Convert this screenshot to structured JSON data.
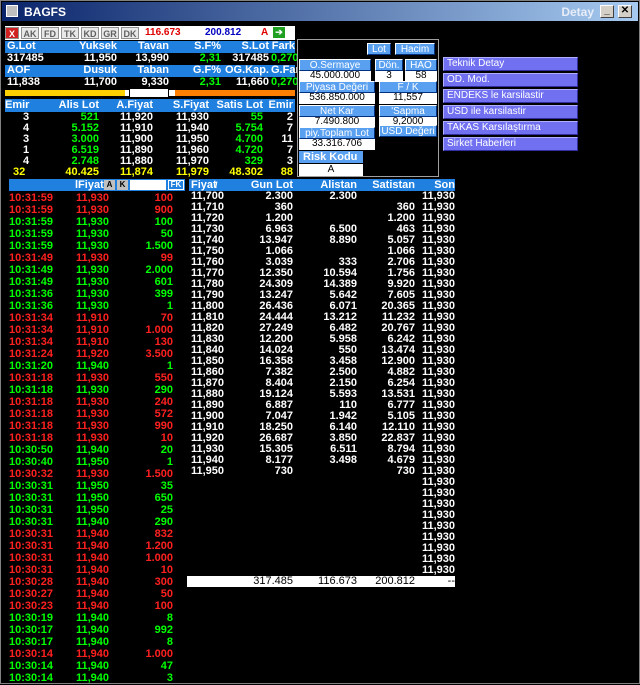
{
  "window": {
    "title": "BAGFS",
    "detail": "Detay"
  },
  "toolbar": {
    "close_label": "X",
    "tabs": [
      "AK",
      "FD",
      "TK",
      "KD",
      "GR",
      "DK"
    ],
    "price_red": "116.673",
    "price_blue": "200.812",
    "a_label": "A"
  },
  "summary": {
    "row1_headers": [
      "G.Lot",
      "Yuksek",
      "Tavan",
      "S.F%",
      "S.Lot",
      "Fark"
    ],
    "row1_values": [
      "317485",
      "11,950",
      "13,990",
      "2,31",
      "317485",
      "0,270"
    ],
    "row2_headers": [
      "AOF",
      "Dusuk",
      "Taban",
      "G.F%",
      "OG.Kap.",
      "G.Fark"
    ],
    "row2_values": [
      "11,838",
      "11,700",
      "9,330",
      "2,31",
      "11,660",
      "0,270"
    ]
  },
  "info_panel": {
    "lot_label": "Lot",
    "hacim_label": "Hacim",
    "osermaye_label": "O.Sermaye",
    "osermaye_value": "45.000.000",
    "don_label": "Dön.",
    "don_value": "3",
    "hao_label": "HAO",
    "hao_value": "58",
    "piyasa_label": "Piyasa Değeri",
    "piyasa_value": "536.850.000",
    "fk_label": "F / K",
    "fk_value": "11,557",
    "netkar_label": "Net Kar",
    "netkar_value": "7.490.800",
    "sapma_label": "'Sapma",
    "sapma_value": "9,2000",
    "ptoplam_label": "piy.Toplam Lot",
    "ptoplam_value": "33.316.706",
    "usd_label": "USD Değeri",
    "risk_label": "Risk Kodu",
    "risk_value": "A"
  },
  "menu": [
    "Teknik Detay",
    "OD. Mod.",
    "ENDEKS le karsilastir",
    "USD ile karsilastir",
    "TAKAS Karsılaştırma",
    "Sirket Haberleri"
  ],
  "depth": {
    "headers": [
      "Emir",
      "Alis Lot",
      "A.Fiyat",
      "S.Fiyat",
      "Satis Lot",
      "Emir"
    ],
    "rows": [
      [
        "3",
        "521",
        "11,920",
        "11,930",
        "55",
        "2"
      ],
      [
        "4",
        "5.152",
        "11,910",
        "11,940",
        "5.754",
        "7"
      ],
      [
        "3",
        "3.000",
        "11,900",
        "11,950",
        "4.700",
        "11"
      ],
      [
        "1",
        "6.519",
        "11,890",
        "11,960",
        "4.720",
        "7"
      ],
      [
        "4",
        "2.748",
        "11,880",
        "11,970",
        "329",
        "3"
      ]
    ],
    "totals": [
      "32",
      "40.425",
      "11,874",
      "11,979",
      "48.302",
      "88"
    ]
  },
  "trades": {
    "header_fiyat": "lFiyat",
    "a_btn": "A",
    "k_btn": "K",
    "fk_btn": "FK",
    "rows": [
      [
        "10:31:59",
        "11,930",
        "100",
        "r"
      ],
      [
        "10:31:59",
        "11,930",
        "900",
        "r"
      ],
      [
        "10:31:59",
        "11,930",
        "100",
        "g"
      ],
      [
        "10:31:59",
        "11,930",
        "50",
        "g"
      ],
      [
        "10:31:59",
        "11,930",
        "1.500",
        "g"
      ],
      [
        "10:31:49",
        "11,930",
        "99",
        "r"
      ],
      [
        "10:31:49",
        "11,930",
        "2.000",
        "g"
      ],
      [
        "10:31:49",
        "11,930",
        "601",
        "g"
      ],
      [
        "10:31:36",
        "11,930",
        "399",
        "g"
      ],
      [
        "10:31:36",
        "11,930",
        "1",
        "g"
      ],
      [
        "10:31:34",
        "11,910",
        "70",
        "r"
      ],
      [
        "10:31:34",
        "11,910",
        "1.000",
        "r"
      ],
      [
        "10:31:34",
        "11,910",
        "130",
        "r"
      ],
      [
        "10:31:24",
        "11,920",
        "3.500",
        "r"
      ],
      [
        "10:31:20",
        "11,940",
        "1",
        "g"
      ],
      [
        "10:31:18",
        "11,930",
        "550",
        "r"
      ],
      [
        "10:31:18",
        "11,930",
        "290",
        "g"
      ],
      [
        "10:31:18",
        "11,930",
        "240",
        "r"
      ],
      [
        "10:31:18",
        "11,930",
        "572",
        "r"
      ],
      [
        "10:31:18",
        "11,930",
        "990",
        "r"
      ],
      [
        "10:31:18",
        "11,930",
        "10",
        "r"
      ],
      [
        "10:30:50",
        "11,940",
        "20",
        "g"
      ],
      [
        "10:30:40",
        "11,950",
        "1",
        "g"
      ],
      [
        "10:30:32",
        "11,930",
        "1.500",
        "r"
      ],
      [
        "10:30:31",
        "11,950",
        "35",
        "g"
      ],
      [
        "10:30:31",
        "11,950",
        "650",
        "g"
      ],
      [
        "10:30:31",
        "11,950",
        "25",
        "g"
      ],
      [
        "10:30:31",
        "11,940",
        "290",
        "g"
      ],
      [
        "10:30:31",
        "11,940",
        "832",
        "r"
      ],
      [
        "10:30:31",
        "11,940",
        "1.200",
        "r"
      ],
      [
        "10:30:31",
        "11,940",
        "1.000",
        "r"
      ],
      [
        "10:30:31",
        "11,940",
        "10",
        "r"
      ],
      [
        "10:30:28",
        "11,940",
        "300",
        "r"
      ],
      [
        "10:30:27",
        "11,940",
        "50",
        "r"
      ],
      [
        "10:30:23",
        "11,940",
        "100",
        "r"
      ],
      [
        "10:30:19",
        "11,940",
        "8",
        "g"
      ],
      [
        "10:30:17",
        "11,940",
        "992",
        "g"
      ],
      [
        "10:30:17",
        "11,940",
        "8",
        "g"
      ],
      [
        "10:30:14",
        "11,940",
        "1.000",
        "r"
      ],
      [
        "10:30:14",
        "11,940",
        "47",
        "g"
      ],
      [
        "10:30:14",
        "11,940",
        "3",
        "g"
      ]
    ]
  },
  "volume": {
    "headers": [
      "Fiyat",
      "Gun Lot",
      "Alistan",
      "Satistan",
      "Son"
    ],
    "rows": [
      [
        "11,700",
        "2.300",
        "2.300",
        "",
        "11,930"
      ],
      [
        "11,710",
        "360",
        "",
        "360",
        "11,930"
      ],
      [
        "11,720",
        "1.200",
        "",
        "1.200",
        "11,930"
      ],
      [
        "11,730",
        "6.963",
        "6.500",
        "463",
        "11,930"
      ],
      [
        "11,740",
        "13.947",
        "8.890",
        "5.057",
        "11,930"
      ],
      [
        "11,750",
        "1.066",
        "",
        "1.066",
        "11,930"
      ],
      [
        "11,760",
        "3.039",
        "333",
        "2.706",
        "11,930"
      ],
      [
        "11,770",
        "12.350",
        "10.594",
        "1.756",
        "11,930"
      ],
      [
        "11,780",
        "24.309",
        "14.389",
        "9.920",
        "11,930"
      ],
      [
        "11,790",
        "13.247",
        "5.642",
        "7.605",
        "11,930"
      ],
      [
        "11,800",
        "26.436",
        "6.071",
        "20.365",
        "11,930"
      ],
      [
        "11,810",
        "24.444",
        "13.212",
        "11.232",
        "11,930"
      ],
      [
        "11,820",
        "27.249",
        "6.482",
        "20.767",
        "11,930"
      ],
      [
        "11,830",
        "12.200",
        "5.958",
        "6.242",
        "11,930"
      ],
      [
        "11,840",
        "14.024",
        "550",
        "13.474",
        "11,930"
      ],
      [
        "11,850",
        "16.358",
        "3.458",
        "12.900",
        "11,930"
      ],
      [
        "11,860",
        "7.382",
        "2.500",
        "4.882",
        "11,930"
      ],
      [
        "11,870",
        "8.404",
        "2.150",
        "6.254",
        "11,930"
      ],
      [
        "11,880",
        "19.124",
        "5.593",
        "13.531",
        "11,930"
      ],
      [
        "11,890",
        "6.887",
        "110",
        "6.777",
        "11,930"
      ],
      [
        "11,900",
        "7.047",
        "1.942",
        "5.105",
        "11,930"
      ],
      [
        "11,910",
        "18.250",
        "6.140",
        "12.110",
        "11,930"
      ],
      [
        "11,920",
        "26.687",
        "3.850",
        "22.837",
        "11,930"
      ],
      [
        "11,930",
        "15.305",
        "6.511",
        "8.794",
        "11,930"
      ],
      [
        "11,940",
        "8.177",
        "3.498",
        "4.679",
        "11,930"
      ],
      [
        "11,950",
        "730",
        "",
        "730",
        "11,930"
      ],
      [
        "",
        "",
        "",
        "",
        "11,930"
      ],
      [
        "",
        "",
        "",
        "",
        "11,930"
      ],
      [
        "",
        "",
        "",
        "",
        "11,930"
      ],
      [
        "",
        "",
        "",
        "",
        "11,930"
      ],
      [
        "",
        "",
        "",
        "",
        "11,930"
      ],
      [
        "",
        "",
        "",
        "",
        "11,930"
      ],
      [
        "",
        "",
        "",
        "",
        "11,930"
      ],
      [
        "",
        "",
        "",
        "",
        "11,930"
      ],
      [
        "",
        "",
        "",
        "",
        "11,930"
      ],
      [
        "",
        "",
        "",
        "",
        "11,930"
      ]
    ],
    "totals": [
      "317.485",
      "116.673",
      "200.812",
      "--"
    ]
  }
}
